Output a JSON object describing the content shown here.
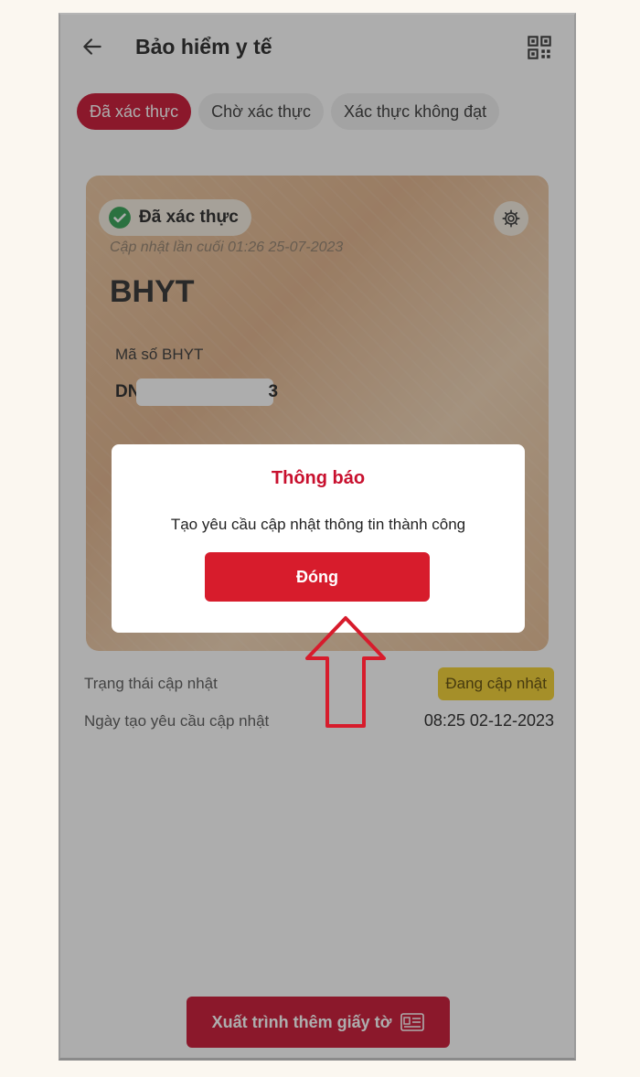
{
  "header": {
    "title": "Bảo hiểm y tế"
  },
  "tabs": [
    {
      "label": "Đã xác thực",
      "active": true
    },
    {
      "label": "Chờ xác thực",
      "active": false
    },
    {
      "label": "Xác thực không đạt",
      "active": false
    }
  ],
  "card": {
    "status": "Đã xác thực",
    "last_updated": "Cập nhật lần cuối 01:26 25-07-2023",
    "title": "BHYT",
    "id_label": "Mã số BHYT",
    "id_prefix": "DN",
    "id_suffix": "3"
  },
  "info": {
    "update_status_label": "Trạng thái cập nhật",
    "update_status_value": "Đang cập nhật",
    "request_date_label": "Ngày tạo yêu cầu cập nhật",
    "request_date_value": "08:25 02-12-2023"
  },
  "bottom_button": {
    "label": "Xuất trình thêm giấy tờ"
  },
  "modal": {
    "title": "Thông báo",
    "message": "Tạo yêu cầu cập nhật thông tin thành công",
    "button_label": "Đóng"
  },
  "colors": {
    "brand_red": "#c8102e",
    "badge_yellow": "#f3cf2a",
    "check_green": "#2e9e4f"
  },
  "icons": [
    "back-arrow-icon",
    "qr-code-icon",
    "check-circle-icon",
    "gear-icon",
    "document-icon",
    "annotation-arrow"
  ]
}
